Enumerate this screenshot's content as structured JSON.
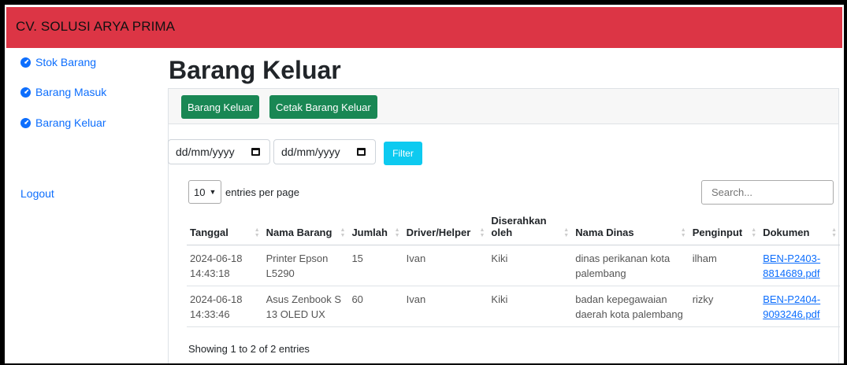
{
  "brand": "CV. SOLUSI ARYA PRIMA",
  "sidebar": {
    "items": [
      {
        "label": "Stok Barang"
      },
      {
        "label": "Barang Masuk"
      },
      {
        "label": "Barang Keluar"
      }
    ],
    "logout": "Logout"
  },
  "page": {
    "title": "Barang Keluar",
    "buttons": {
      "add": "Barang Keluar",
      "print": "Cetak Barang Keluar"
    },
    "filter": {
      "start_date": "dd/mm/yyyy",
      "end_date": "dd/mm/yyyy",
      "button": "Filter"
    },
    "length": {
      "value": "10",
      "label": "entries per page"
    },
    "search": {
      "placeholder": "Search..."
    },
    "info": "Showing 1 to 2 of 2 entries"
  },
  "table": {
    "headers": [
      "Tanggal",
      "Nama Barang",
      "Jumlah",
      "Driver/Helper",
      "Diserahkan oleh",
      "Nama Dinas",
      "Penginput",
      "Dokumen"
    ],
    "rows": [
      {
        "tanggal": "2024-06-18 14:43:18",
        "nama_barang": "Printer Epson L5290",
        "jumlah": "15",
        "driver": "Ivan",
        "diserahkan": "Kiki",
        "dinas": "dinas perikanan kota palembang",
        "penginput": "ilham",
        "dokumen": "BEN-P2403-8814689.pdf"
      },
      {
        "tanggal": "2024-06-18 14:33:46",
        "nama_barang": "Asus Zenbook S 13 OLED UX",
        "jumlah": "60",
        "driver": "Ivan",
        "diserahkan": "Kiki",
        "dinas": "badan kepegawaian daerah kota palembang",
        "penginput": "rizky",
        "dokumen": "BEN-P2404-9093246.pdf"
      }
    ]
  },
  "colors": {
    "navbar": "#dc3545",
    "success": "#198754",
    "info": "#0dcaf0",
    "link": "#0d6efd"
  }
}
